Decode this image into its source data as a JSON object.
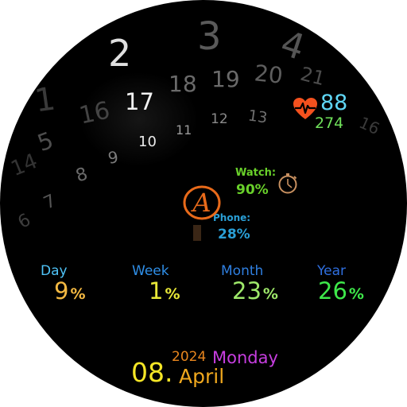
{
  "hour_dial": {
    "bg_numbers": [
      "1",
      "3",
      "4",
      "5",
      "6",
      "7",
      "8",
      "9",
      "11",
      "12",
      "13",
      "14",
      "15",
      "16",
      "18",
      "19",
      "20",
      "21",
      "16"
    ],
    "big_number": "2",
    "current_hour": "17",
    "pointer_number": "10"
  },
  "heart": {
    "icon": "heart-pulse-icon",
    "bpm": "88",
    "secondary": "274"
  },
  "battery": {
    "watch_label": "Watch:",
    "watch_value": "90%",
    "phone_label": "Phone:",
    "phone_value": "28%",
    "watch_icon": "stopwatch-icon"
  },
  "logo": {
    "letter": "A"
  },
  "progress": [
    {
      "label": "Day",
      "value": "9",
      "unit": "%",
      "label_color": "#4fc3f7",
      "value_color": "#f4b942",
      "unit_color": "#f4b942"
    },
    {
      "label": "Week",
      "value": "1",
      "unit": "%",
      "label_color": "#2f8fe8",
      "value_color": "#e8e838",
      "unit_color": "#e8e838"
    },
    {
      "label": "Month",
      "value": "23",
      "unit": "%",
      "label_color": "#2f7fe0",
      "value_color": "#9ee86a",
      "unit_color": "#9ee86a"
    },
    {
      "label": "Year",
      "value": "26",
      "unit": "%",
      "label_color": "#2f6fe0",
      "value_color": "#3ee84a",
      "unit_color": "#3ee84a"
    }
  ],
  "date": {
    "day": "08.",
    "year": "2024",
    "weekday": "Monday",
    "month": "April"
  }
}
